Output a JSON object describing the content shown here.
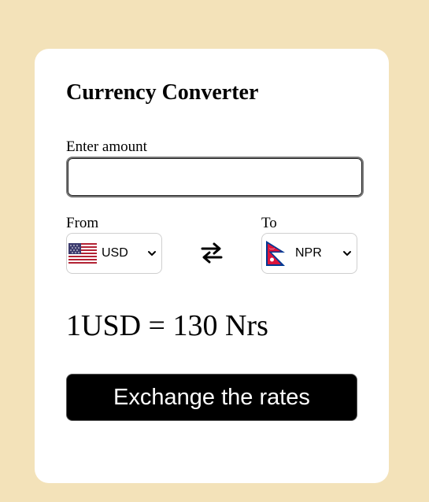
{
  "converter": {
    "title": "Currency Converter",
    "amount_label": "Enter amount",
    "amount_value": "",
    "from_label": "From",
    "to_label": "To",
    "from_currency": {
      "code": "USD",
      "flag_icon": "us-flag-icon"
    },
    "to_currency": {
      "code": "NPR",
      "flag_icon": "nepal-flag-icon"
    },
    "swap_icon": "swap-arrows-icon",
    "rate": {
      "amount": "1",
      "currency": "USD",
      "equals": "=",
      "value": "130",
      "unit": "Nrs"
    },
    "exchange_button_label": "Exchange the rates"
  },
  "colors": {
    "background": "#f3e2b9",
    "card": "#ffffff",
    "button": "#000000",
    "button_text": "#ffffff"
  }
}
